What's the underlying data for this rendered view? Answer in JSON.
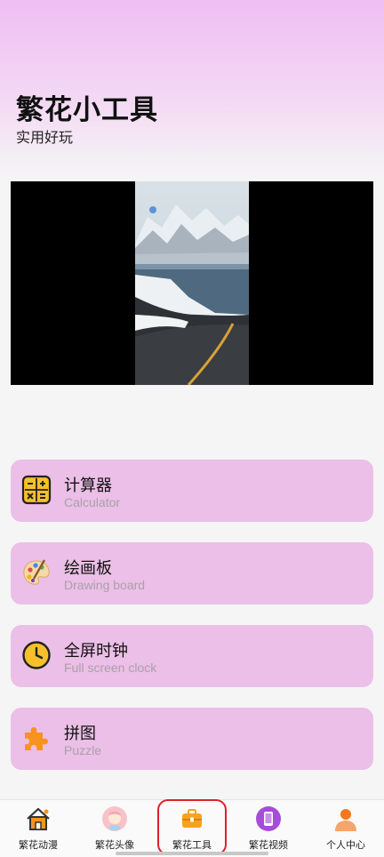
{
  "header": {
    "title": "繁花小工具",
    "subtitle": "实用好玩"
  },
  "tools": [
    {
      "title": "计算器",
      "subtitle": "Calculator",
      "icon": "calculator-icon"
    },
    {
      "title": "绘画板",
      "subtitle": "Drawing board",
      "icon": "palette-icon"
    },
    {
      "title": "全屏时钟",
      "subtitle": "Full screen clock",
      "icon": "clock-icon"
    },
    {
      "title": "拼图",
      "subtitle": "Puzzle",
      "icon": "puzzle-icon"
    }
  ],
  "tabbar": {
    "items": [
      {
        "label": "繁花动漫",
        "icon": "home-icon"
      },
      {
        "label": "繁花头像",
        "icon": "avatar-icon"
      },
      {
        "label": "繁花工具",
        "icon": "toolbox-icon",
        "selected": true
      },
      {
        "label": "繁花视频",
        "icon": "phone-icon"
      },
      {
        "label": "个人中心",
        "icon": "person-icon"
      }
    ]
  },
  "colors": {
    "card": "#ebbfe7",
    "header_gradient_top": "#efbdf2",
    "highlight": "#e0202b"
  }
}
